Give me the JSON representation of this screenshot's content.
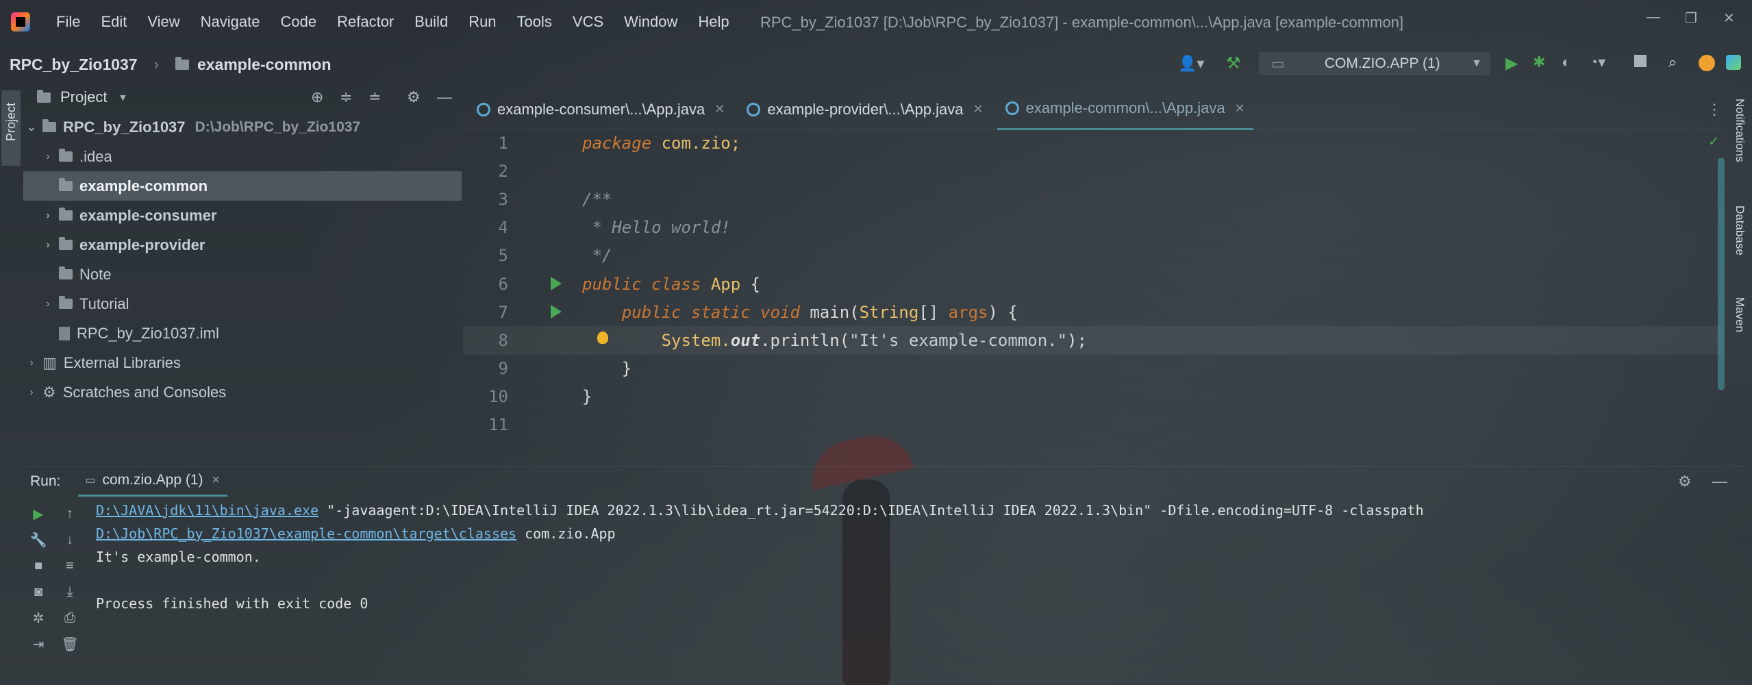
{
  "menu": [
    "File",
    "Edit",
    "View",
    "Navigate",
    "Code",
    "Refactor",
    "Build",
    "Run",
    "Tools",
    "VCS",
    "Window",
    "Help"
  ],
  "window_title": "RPC_by_Zio1037 [D:\\Job\\RPC_by_Zio1037] - example-common\\...\\App.java [example-common]",
  "breadcrumb": {
    "project": "RPC_by_Zio1037",
    "module": "example-common"
  },
  "run_config": "COM.ZIO.APP (1)",
  "left_stripe": {
    "project": "Project"
  },
  "project_panel": {
    "title": "Project",
    "tree": [
      {
        "label": "RPC_by_Zio1037",
        "sub": "D:\\Job\\RPC_by_Zio1037"
      },
      {
        "label": ".idea"
      },
      {
        "label": "example-common"
      },
      {
        "label": "example-consumer"
      },
      {
        "label": "example-provider"
      },
      {
        "label": "Note"
      },
      {
        "label": "Tutorial"
      },
      {
        "label": "RPC_by_Zio1037.iml"
      },
      {
        "label": "External Libraries"
      },
      {
        "label": "Scratches and Consoles"
      }
    ]
  },
  "tabs": [
    {
      "label": "example-consumer\\...\\App.java"
    },
    {
      "label": "example-provider\\...\\App.java"
    },
    {
      "label": "example-common\\...\\App.java"
    }
  ],
  "editor": {
    "line_numbers": [
      "1",
      "2",
      "3",
      "4",
      "5",
      "6",
      "7",
      "8",
      "9",
      "10",
      "11"
    ],
    "l1_kw": "package",
    "l1_rest": " com.zio;",
    "l3": "/**",
    "l4": " * Hello world!",
    "l5": " */",
    "l6_kw1": "public",
    "l6_kw2": "class",
    "l6_cls": "App",
    "l6_rest": " {",
    "l7_kw1": "public",
    "l7_kw2": "static",
    "l7_kw3": "void",
    "l7_fn": "main",
    "l7_p1": "(",
    "l7_type": "String",
    "l7_p2": "[] ",
    "l7_arg": "args",
    "l7_p3": ") {",
    "l8_a": "System.",
    "l8_b": "out",
    "l8_c": ".println(",
    "l8_str": "\"It's example-common.\"",
    "l8_d": ");",
    "l9": "}",
    "l10": "}"
  },
  "run_panel": {
    "label": "Run:",
    "tab": "com.zio.App (1)",
    "console": {
      "l1_link": "D:\\JAVA\\jdk\\11\\bin\\java.exe",
      "l1_rest": " \"-javaagent:D:\\IDEA\\IntelliJ IDEA 2022.1.3\\lib\\idea_rt.jar=54220:D:\\IDEA\\IntelliJ IDEA 2022.1.3\\bin\" -Dfile.encoding=UTF-8 -classpath",
      "l2_link": "D:\\Job\\RPC_by_Zio1037\\example-common\\target\\classes",
      "l2_rest": " com.zio.App",
      "l3": "It's example-common.",
      "l4": "",
      "l5": "Process finished with exit code 0"
    }
  },
  "right_stripe": {
    "notifications": "Notifications",
    "database": "Database",
    "maven": "Maven"
  }
}
